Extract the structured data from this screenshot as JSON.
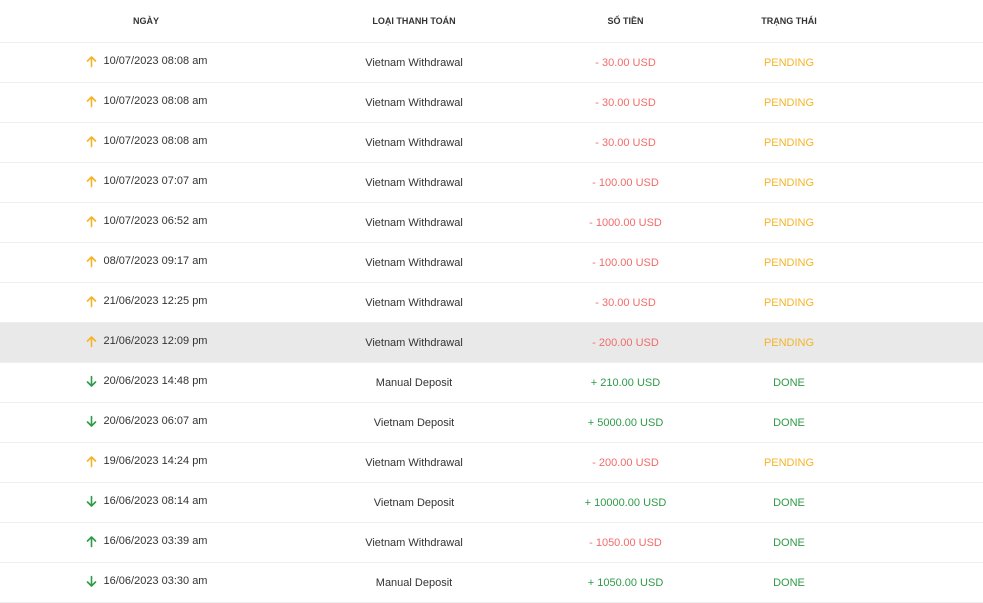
{
  "headers": {
    "date": "NGÀY",
    "type": "LOẠI THANH TOÁN",
    "amount": "SỐ TIỀN",
    "status": "TRẠNG THÁI"
  },
  "colors": {
    "negative": "#f26b6b",
    "positive": "#2e9a4a",
    "pending": "#f5b428",
    "done": "#2e9a4a",
    "arrow_up_pending": "#f5b428",
    "arrow_up_done": "#2e9a4a",
    "arrow_down": "#2e9a4a"
  },
  "rows": [
    {
      "direction": "up",
      "arrow_color": "#f5b428",
      "date": "10/07/2023 08:08 am",
      "type": "Vietnam Withdrawal",
      "amount": "- 30.00 USD",
      "sign": "neg",
      "status": "PENDING",
      "status_kind": "pending",
      "highlighted": false
    },
    {
      "direction": "up",
      "arrow_color": "#f5b428",
      "date": "10/07/2023 08:08 am",
      "type": "Vietnam Withdrawal",
      "amount": "- 30.00 USD",
      "sign": "neg",
      "status": "PENDING",
      "status_kind": "pending",
      "highlighted": false
    },
    {
      "direction": "up",
      "arrow_color": "#f5b428",
      "date": "10/07/2023 08:08 am",
      "type": "Vietnam Withdrawal",
      "amount": "- 30.00 USD",
      "sign": "neg",
      "status": "PENDING",
      "status_kind": "pending",
      "highlighted": false
    },
    {
      "direction": "up",
      "arrow_color": "#f5b428",
      "date": "10/07/2023 07:07 am",
      "type": "Vietnam Withdrawal",
      "amount": "- 100.00 USD",
      "sign": "neg",
      "status": "PENDING",
      "status_kind": "pending",
      "highlighted": false
    },
    {
      "direction": "up",
      "arrow_color": "#f5b428",
      "date": "10/07/2023 06:52 am",
      "type": "Vietnam Withdrawal",
      "amount": "- 1000.00 USD",
      "sign": "neg",
      "status": "PENDING",
      "status_kind": "pending",
      "highlighted": false
    },
    {
      "direction": "up",
      "arrow_color": "#f5b428",
      "date": "08/07/2023 09:17 am",
      "type": "Vietnam Withdrawal",
      "amount": "- 100.00 USD",
      "sign": "neg",
      "status": "PENDING",
      "status_kind": "pending",
      "highlighted": false
    },
    {
      "direction": "up",
      "arrow_color": "#f5b428",
      "date": "21/06/2023 12:25 pm",
      "type": "Vietnam Withdrawal",
      "amount": "- 30.00 USD",
      "sign": "neg",
      "status": "PENDING",
      "status_kind": "pending",
      "highlighted": false
    },
    {
      "direction": "up",
      "arrow_color": "#f5b428",
      "date": "21/06/2023 12:09 pm",
      "type": "Vietnam Withdrawal",
      "amount": "- 200.00 USD",
      "sign": "neg",
      "status": "PENDING",
      "status_kind": "pending",
      "highlighted": true
    },
    {
      "direction": "down",
      "arrow_color": "#2e9a4a",
      "date": "20/06/2023 14:48 pm",
      "type": "Manual Deposit",
      "amount": "+ 210.00 USD",
      "sign": "pos",
      "status": "DONE",
      "status_kind": "done",
      "highlighted": false
    },
    {
      "direction": "down",
      "arrow_color": "#2e9a4a",
      "date": "20/06/2023 06:07 am",
      "type": "Vietnam Deposit",
      "amount": "+ 5000.00 USD",
      "sign": "pos",
      "status": "DONE",
      "status_kind": "done",
      "highlighted": false
    },
    {
      "direction": "up",
      "arrow_color": "#f5b428",
      "date": "19/06/2023 14:24 pm",
      "type": "Vietnam Withdrawal",
      "amount": "- 200.00 USD",
      "sign": "neg",
      "status": "PENDING",
      "status_kind": "pending",
      "highlighted": false
    },
    {
      "direction": "down",
      "arrow_color": "#2e9a4a",
      "date": "16/06/2023 08:14 am",
      "type": "Vietnam Deposit",
      "amount": "+ 10000.00 USD",
      "sign": "pos",
      "status": "DONE",
      "status_kind": "done",
      "highlighted": false
    },
    {
      "direction": "up",
      "arrow_color": "#2e9a4a",
      "date": "16/06/2023 03:39 am",
      "type": "Vietnam Withdrawal",
      "amount": "- 1050.00 USD",
      "sign": "neg",
      "status": "DONE",
      "status_kind": "done",
      "highlighted": false
    },
    {
      "direction": "down",
      "arrow_color": "#2e9a4a",
      "date": "16/06/2023 03:30 am",
      "type": "Manual Deposit",
      "amount": "+ 1050.00 USD",
      "sign": "pos",
      "status": "DONE",
      "status_kind": "done",
      "highlighted": false
    }
  ]
}
